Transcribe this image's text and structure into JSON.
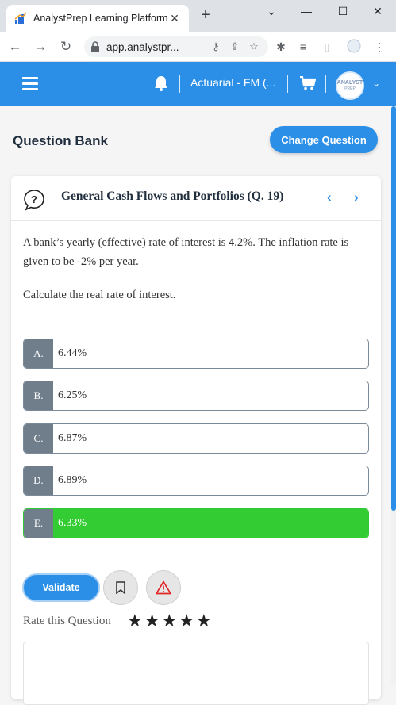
{
  "browser": {
    "tab_title": "AnalystPrep Learning Platform",
    "tab_close": "✕",
    "new_tab": "+",
    "url": "app.analystpr...",
    "window_controls": {
      "dropdown": "⌄",
      "minimize": "—",
      "maximize": "☐",
      "close": "✕"
    },
    "icons": [
      "back-icon",
      "forward-icon",
      "reload-icon",
      "lock-icon",
      "key-icon",
      "share-icon",
      "star-icon",
      "extensions-icon",
      "media-icon",
      "side-panel-icon",
      "profile-icon",
      "menu-icon"
    ]
  },
  "header": {
    "course": "Actuarial - FM (...",
    "avatar_line1": "ANALYST",
    "avatar_line2": "PREP",
    "accent_color": "#2b8fe8"
  },
  "page": {
    "title": "Question Bank",
    "change_button": "Change Question"
  },
  "question": {
    "title": "General Cash Flows and Portfolios (Q. 19)",
    "body": "A bank’s yearly (effective) rate of interest is 4.2%. The inflation rate is given to be -2% per year.",
    "ask": "Calculate the real rate of interest.",
    "options": [
      {
        "letter": "A.",
        "text": "6.44%",
        "selected": false
      },
      {
        "letter": "B.",
        "text": "6.25%",
        "selected": false
      },
      {
        "letter": "C.",
        "text": "6.87%",
        "selected": false
      },
      {
        "letter": "D.",
        "text": "6.89%",
        "selected": false
      },
      {
        "letter": "E.",
        "text": "6.33%",
        "selected": true
      }
    ],
    "correct_color": "#33cc33"
  },
  "actions": {
    "validate": "Validate",
    "rate_label": "Rate this Question",
    "stars": [
      "★",
      "★",
      "★",
      "★",
      "★"
    ]
  }
}
